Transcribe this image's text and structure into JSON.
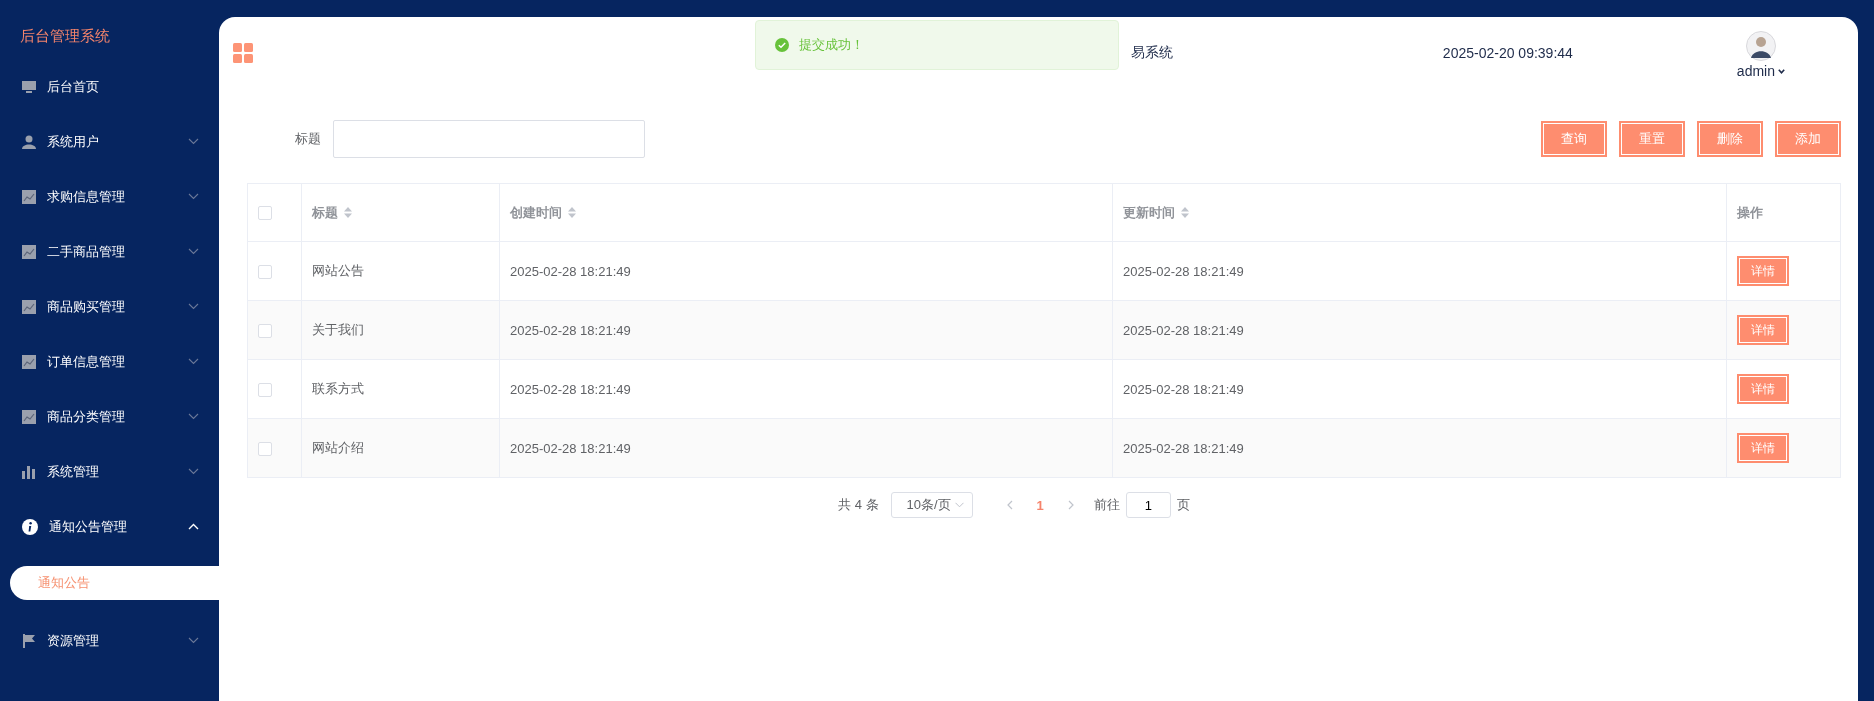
{
  "sidebar": {
    "title": "后台管理系统",
    "items": [
      {
        "label": "后台首页",
        "kind": "link"
      },
      {
        "label": "系统用户",
        "kind": "group",
        "expanded": false
      },
      {
        "label": "求购信息管理",
        "kind": "group",
        "expanded": false
      },
      {
        "label": "二手商品管理",
        "kind": "group",
        "expanded": false
      },
      {
        "label": "商品购买管理",
        "kind": "group",
        "expanded": false
      },
      {
        "label": "订单信息管理",
        "kind": "group",
        "expanded": false
      },
      {
        "label": "商品分类管理",
        "kind": "group",
        "expanded": false
      },
      {
        "label": "系统管理",
        "kind": "group",
        "expanded": false
      },
      {
        "label": "通知公告管理",
        "kind": "group",
        "expanded": true,
        "children": [
          {
            "label": "通知公告",
            "selected": true
          }
        ]
      },
      {
        "label": "资源管理",
        "kind": "group",
        "expanded": false
      }
    ]
  },
  "header": {
    "system_title": "易系统",
    "datetime": "2025-02-20 09:39:44",
    "user": {
      "name": "admin"
    }
  },
  "toast": {
    "kind": "success",
    "message": "提交成功！"
  },
  "search": {
    "fields": [
      {
        "label": "标题"
      }
    ],
    "buttons": [
      "查询",
      "重置",
      "删除",
      "添加"
    ]
  },
  "table": {
    "select_all_checked": false,
    "columns": [
      {
        "label": "标题",
        "sortable": true
      },
      {
        "label": "创建时间",
        "sortable": true
      },
      {
        "label": "更新时间",
        "sortable": true
      },
      {
        "label": "操作",
        "sortable": false
      }
    ],
    "rows": [
      {
        "checked": false,
        "title": "网站公告",
        "created": "2025-02-28 18:21:49",
        "updated": "2025-02-28 18:21:49",
        "action": "详情"
      },
      {
        "checked": false,
        "title": "关于我们",
        "created": "2025-02-28 18:21:49",
        "updated": "2025-02-28 18:21:49",
        "action": "详情"
      },
      {
        "checked": false,
        "title": "联系方式",
        "created": "2025-02-28 18:21:49",
        "updated": "2025-02-28 18:21:49",
        "action": "详情"
      },
      {
        "checked": false,
        "title": "网站介绍",
        "created": "2025-02-28 18:21:49",
        "updated": "2025-02-28 18:21:49",
        "action": "详情"
      }
    ]
  },
  "pagination": {
    "total": "共 4 条",
    "page_size": "10条/页",
    "pages": [
      {
        "label": "1",
        "selected": true
      }
    ],
    "goto_label": "前往",
    "goto_value": "1",
    "goto_suffix": "页"
  }
}
